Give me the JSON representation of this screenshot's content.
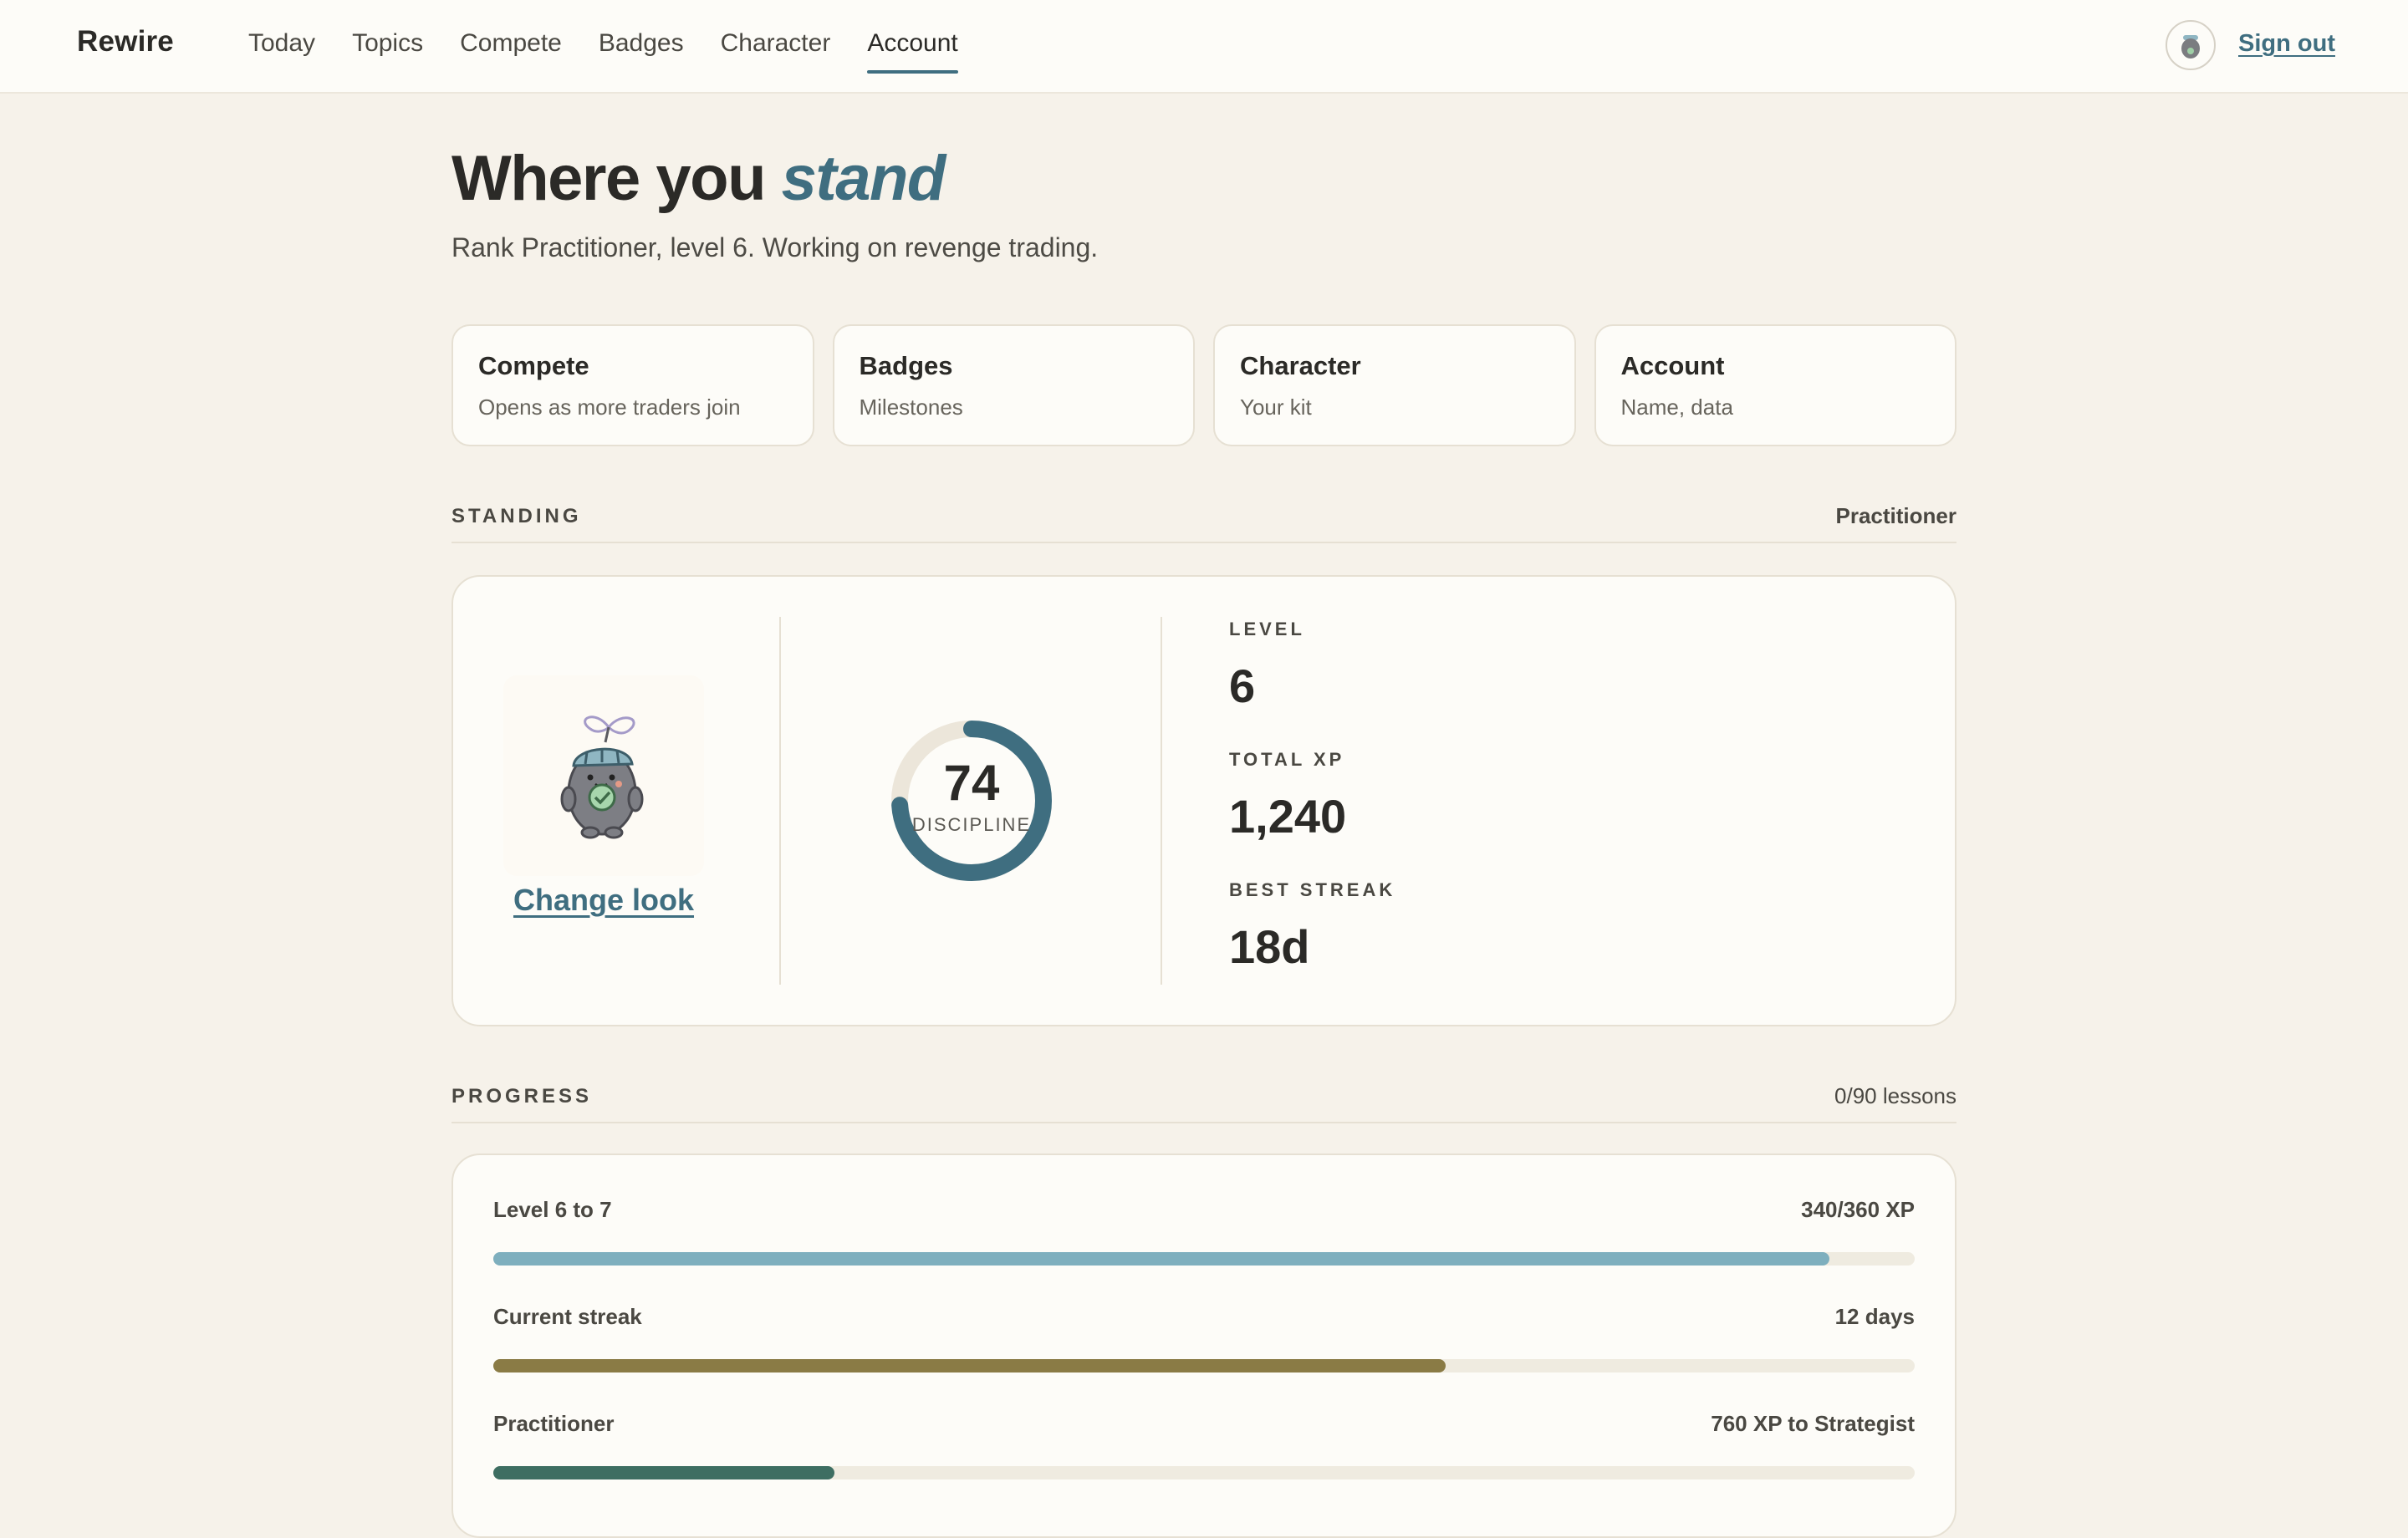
{
  "app": {
    "brand": "Rewire"
  },
  "nav": {
    "items": [
      {
        "label": "Today"
      },
      {
        "label": "Topics"
      },
      {
        "label": "Compete"
      },
      {
        "label": "Badges"
      },
      {
        "label": "Character"
      },
      {
        "label": "Account",
        "active": true
      }
    ],
    "sign_out": "Sign out",
    "avatar_icon": "character-avatar-icon"
  },
  "header": {
    "title_plain": "Where you ",
    "title_accent": "stand",
    "subtitle": "Rank Practitioner, level 6. Working on revenge trading."
  },
  "cards": [
    {
      "title": "Compete",
      "sub": "Opens as more traders join"
    },
    {
      "title": "Badges",
      "sub": "Milestones"
    },
    {
      "title": "Character",
      "sub": "Your kit"
    },
    {
      "title": "Account",
      "sub": "Name, data"
    }
  ],
  "standing": {
    "label": "STANDING",
    "rank": "Practitioner",
    "change_look": "Change look",
    "discipline": {
      "value": "74",
      "label": "DISCIPLINE",
      "percent": 74
    },
    "level": {
      "label": "LEVEL",
      "value": "6"
    },
    "total_xp": {
      "label": "TOTAL XP",
      "value": "1,240"
    },
    "best_streak": {
      "label": "BEST STREAK",
      "value": "18d"
    }
  },
  "progress": {
    "label": "PROGRESS",
    "lessons": "0/90 lessons",
    "rows": [
      {
        "label": "Level 6 to 7",
        "value": "340/360 XP",
        "fraction": 0.94,
        "color": "#7eafbe"
      },
      {
        "label": "Current streak",
        "value": "12 days",
        "fraction": 0.67,
        "color": "#8a7b45"
      },
      {
        "label": "Practitioner",
        "value": "760 XP to Strategist",
        "fraction": 0.24,
        "color": "#3e6e62"
      }
    ]
  },
  "colors": {
    "accent": "#3f6e80",
    "background": "#f6f2ea",
    "panel": "#fdfcf8",
    "ring_track": "#ece6da"
  }
}
